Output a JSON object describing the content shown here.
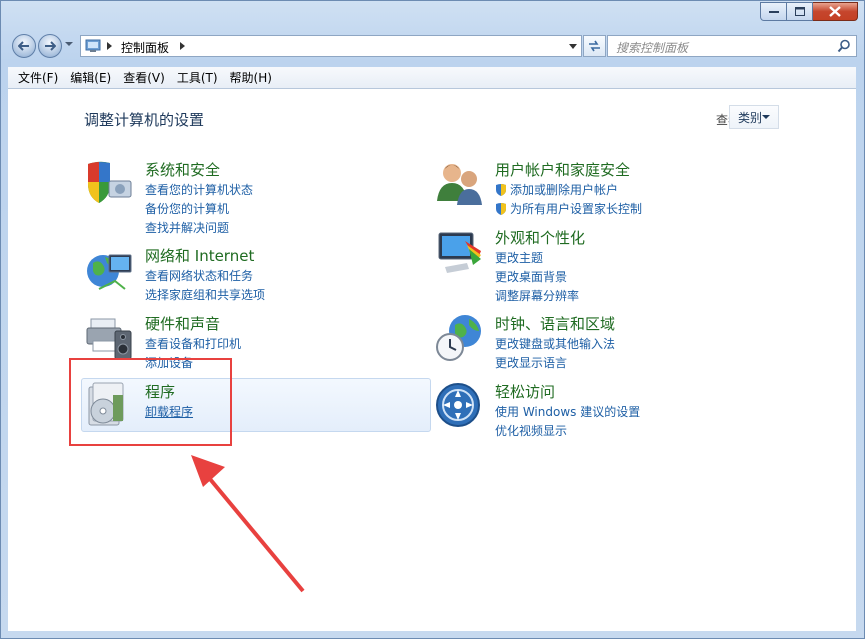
{
  "window": {
    "caption": {
      "minimize": "—",
      "maximize": "▢",
      "close": "✕"
    }
  },
  "address_bar": {
    "breadcrumb": "控制面板"
  },
  "search": {
    "placeholder": "搜索控制面板"
  },
  "menu": [
    "文件(F)",
    "编辑(E)",
    "查看(V)",
    "工具(T)",
    "帮助(H)"
  ],
  "main": {
    "title": "调整计算机的设置",
    "view_by_label": "查看方式:",
    "view_by_value": "类别"
  },
  "categories": [
    {
      "title": "系统和安全",
      "icon": "shield-pc-icon",
      "links": [
        "查看您的计算机状态",
        "备份您的计算机",
        "查找并解决问题"
      ]
    },
    {
      "title": "网络和 Internet",
      "icon": "network-globe-icon",
      "links": [
        "查看网络状态和任务",
        "选择家庭组和共享选项"
      ]
    },
    {
      "title": "硬件和声音",
      "icon": "printer-speaker-icon",
      "links": [
        "查看设备和打印机",
        "添加设备"
      ]
    },
    {
      "title": "程序",
      "icon": "programs-disc-icon",
      "links": [
        "卸载程序"
      ]
    },
    {
      "title": "用户帐户和家庭安全",
      "icon": "users-icon",
      "links": [
        "添加或删除用户帐户",
        "为所有用户设置家长控制"
      ]
    },
    {
      "title": "外观和个性化",
      "icon": "monitor-colors-icon",
      "links": [
        "更改主题",
        "更改桌面背景",
        "调整屏幕分辨率"
      ]
    },
    {
      "title": "时钟、语言和区域",
      "icon": "clock-globe-icon",
      "links": [
        "更改键盘或其他输入法",
        "更改显示语言"
      ]
    },
    {
      "title": "轻松访问",
      "icon": "ease-of-access-icon",
      "links": [
        "使用 Windows 建议的设置",
        "优化视频显示"
      ]
    }
  ],
  "colors": {
    "title_green": "#1f6b21",
    "link_blue": "#1e5fa5",
    "annotation_red": "#e8413f"
  }
}
